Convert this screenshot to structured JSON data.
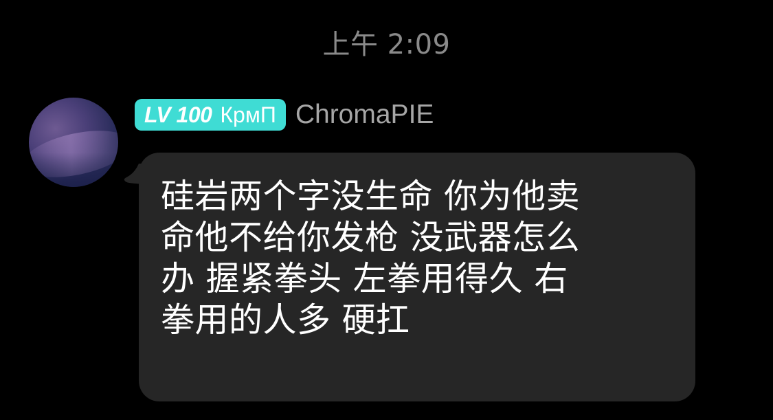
{
  "chat": {
    "timestamp": "上午 2:09",
    "message": {
      "sender": {
        "level_label": "LV 100",
        "title": "КрмП",
        "name": "ChromaPIE",
        "badge_color": "#3fdcd4"
      },
      "lines": [
        "硅岩两个字没生命 你为他卖",
        "命他不给你发枪 没武器怎么",
        "办 握紧拳头 左拳用得久 右",
        "拳用的人多 硬扛"
      ]
    }
  },
  "colors": {
    "background": "#000000",
    "bubble": "#262626",
    "timestamp": "#8a8a8a",
    "sender_name": "#a6a6a6"
  },
  "icons": {
    "avatar": "user-avatar"
  }
}
